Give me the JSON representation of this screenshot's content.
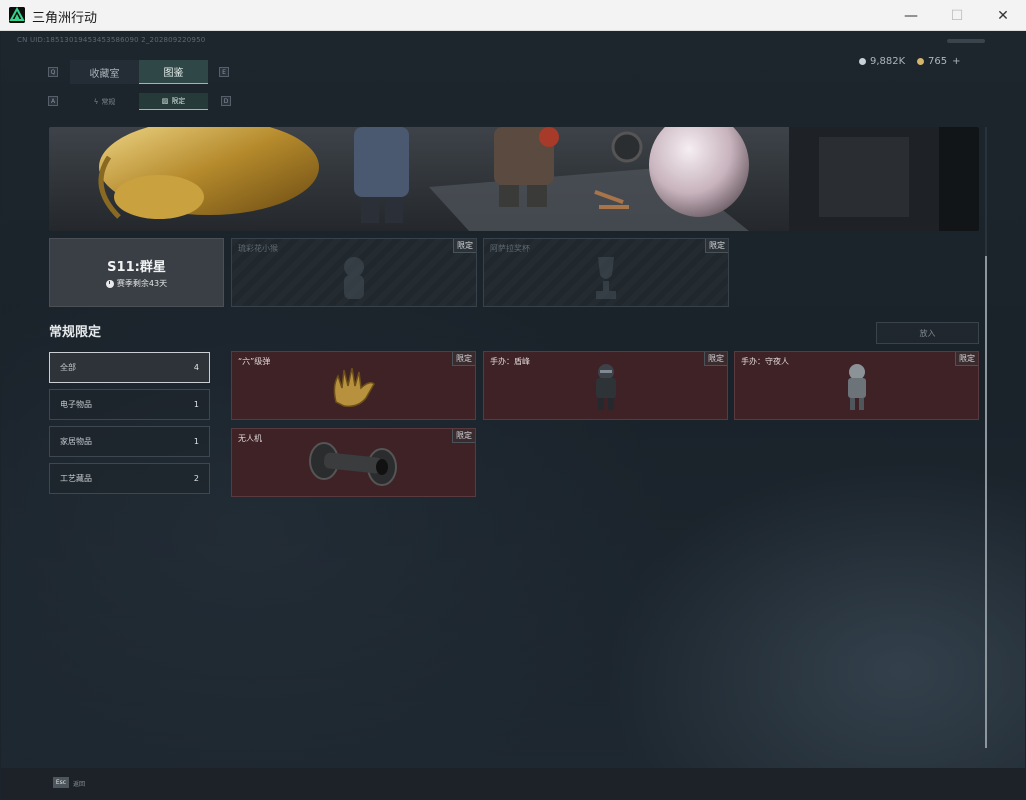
{
  "window": {
    "title": "三角洲行动",
    "minimize_glyph": "—",
    "maximize_glyph": "☐",
    "close_glyph": "✕"
  },
  "header": {
    "uid": "CN UID:18513019453453586090 2_202809220950",
    "currency_1": "9,882K",
    "currency_2": "765",
    "currency_2_plus": "+"
  },
  "tabs": {
    "main": [
      {
        "label": "收藏室",
        "active": false
      },
      {
        "label": "图鉴",
        "active": true
      }
    ],
    "sub": [
      {
        "label": "常规",
        "icon": "lightning-icon",
        "active": false
      },
      {
        "label": "限定",
        "icon": "image-icon",
        "active": true
      }
    ],
    "key_left": "Q",
    "key_right": "E",
    "key_sub_left": "A",
    "key_sub_right": "D"
  },
  "season": {
    "title": "S11:群星",
    "remaining": "赛季剩余43天"
  },
  "locked_cards": [
    {
      "name": "琉彩花小猴",
      "badge": "限定"
    },
    {
      "name": "阿萨拉奖杯",
      "badge": "限定"
    }
  ],
  "section": {
    "title": "常规限定",
    "put_button": "放入"
  },
  "categories": [
    {
      "label": "全部",
      "count": "4",
      "active": true
    },
    {
      "label": "电子物品",
      "count": "1",
      "active": false
    },
    {
      "label": "家居物品",
      "count": "1",
      "active": false
    },
    {
      "label": "工艺藏品",
      "count": "2",
      "active": false
    }
  ],
  "items": [
    {
      "name": "“六”级弹",
      "badge": "限定",
      "icon": "golden-hand-icon"
    },
    {
      "name": "手办：盾峰",
      "badge": "限定",
      "icon": "figure-icon"
    },
    {
      "name": "手办：守夜人",
      "badge": "限定",
      "icon": "figure-icon"
    },
    {
      "name": "无人机",
      "badge": "限定",
      "icon": "drone-icon"
    }
  ],
  "footer": {
    "esc_key": "Esc",
    "esc_label": "返回"
  },
  "colors": {
    "accent": "#7bc9a9",
    "item_bg": "#3e2226",
    "season_bg": "#3a3f45"
  }
}
